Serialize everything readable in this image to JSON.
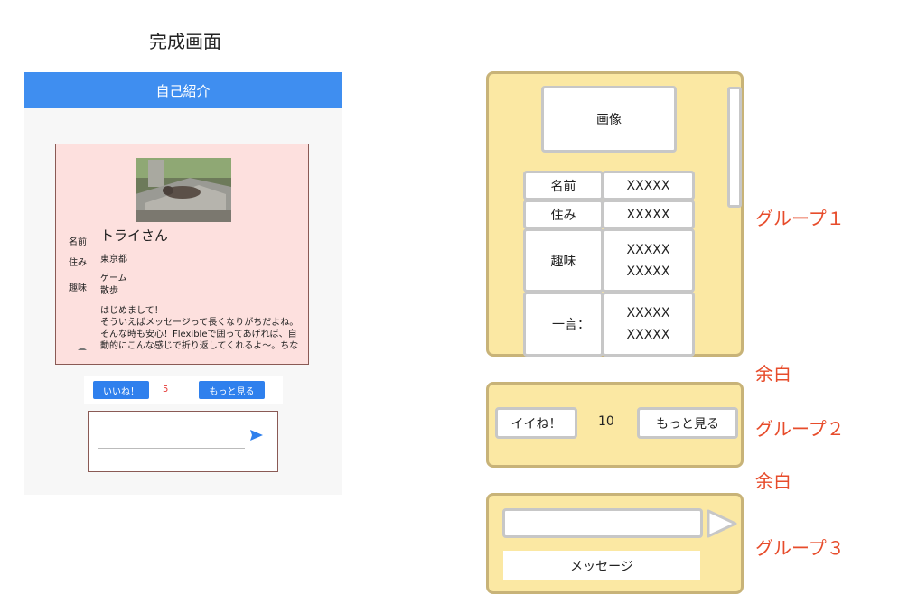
{
  "left": {
    "title": "完成画面",
    "appbar_title": "自己紹介",
    "profile": {
      "name_label": "名前",
      "name_value": "トライさん",
      "home_label": "住み",
      "home_value": "東京都",
      "hobby_label": "趣味",
      "hobby_value_1": "ゲーム",
      "hobby_value_2": "散歩",
      "message_lines": [
        "はじめまして！",
        "そういえばメッセージって長くなりがちだよね。",
        "そんな時も安心！Flexibleで囲ってあげれば、自",
        "動的にこんな感じで折り返してくれるよ〜。ちな"
      ]
    },
    "like_button": "いいね！",
    "like_count": "5",
    "more_button": "もっと見る"
  },
  "right": {
    "group1": {
      "image_label": "画像",
      "rows": [
        {
          "label": "名前",
          "values": [
            "XXXXX"
          ]
        },
        {
          "label": "住み",
          "values": [
            "XXXXX"
          ]
        },
        {
          "label": "趣味",
          "values": [
            "XXXXX",
            "XXXXX"
          ]
        },
        {
          "label": "一言：",
          "values": [
            "XXXXX",
            "XXXXX"
          ]
        }
      ]
    },
    "group2": {
      "like_button": "イイね！",
      "count": "10",
      "more_button": "もっと見る"
    },
    "group3": {
      "message_label": "メッセージ"
    },
    "labels": {
      "group1": "グループ１",
      "margin1": "余白",
      "group2": "グループ２",
      "margin2": "余白",
      "group3": "グループ３"
    }
  },
  "colors": {
    "appbar": "#3f8ef0",
    "card": "#fde0de",
    "group_fill": "#fbe8a3",
    "group_border": "#c8b378",
    "label_red": "#e74c2b"
  }
}
